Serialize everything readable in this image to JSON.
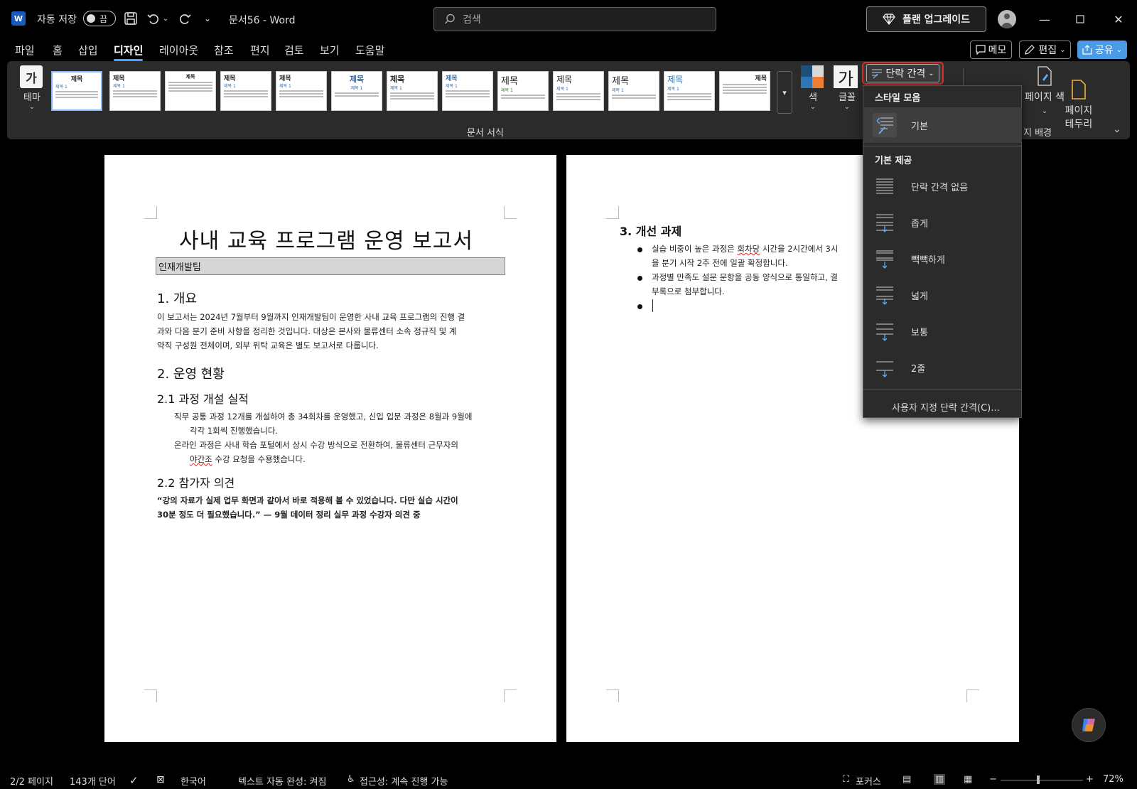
{
  "titlebar": {
    "autosave_label": "자동 저장",
    "autosave_state": "끔",
    "doc_title": "문서56  -  Word",
    "search_placeholder": "검색",
    "upgrade_label": "플랜 업그레이드"
  },
  "tabs": [
    {
      "label": "파일"
    },
    {
      "label": "홈"
    },
    {
      "label": "삽입"
    },
    {
      "label": "디자인"
    },
    {
      "label": "레이아웃"
    },
    {
      "label": "참조"
    },
    {
      "label": "편지"
    },
    {
      "label": "검토"
    },
    {
      "label": "보기"
    },
    {
      "label": "도움말"
    }
  ],
  "header_buttons": {
    "memo": "메모",
    "edit": "편집",
    "share": "공유"
  },
  "ribbon": {
    "theme_label": "테마",
    "color_label": "색",
    "font_label": "글꼴",
    "paragraph_spacing_label": "단락 간격",
    "page_color_label": "페이지 색",
    "page_border_label": "페이지\n테두리",
    "group_document_format": "문서 서식",
    "group_page_background": "지 배경",
    "thumb_title": "제목",
    "thumb_sub": "제목 1",
    "accent": "#4ea1ff"
  },
  "menu": {
    "style_header": "스타일 모음",
    "builtin_header": "기본 제공",
    "items": [
      {
        "label": "기본"
      },
      {
        "label": "단락 간격 없음"
      },
      {
        "label": "좁게"
      },
      {
        "label": "빽빽하게"
      },
      {
        "label": "넓게"
      },
      {
        "label": "보통"
      },
      {
        "label": "2줄"
      }
    ],
    "custom": "사용자 지정 단락 간격(C)..."
  },
  "page1": {
    "title": "사내 교육 프로그램 운영 보고서",
    "subtitle": "인재개발팀",
    "h1_overview": "1. 개요",
    "overview_l1": "이 보고서는 2024년 7월부터 9월까지 인재개발팀이 운영한 사내 교육 프로그램의 진행 결",
    "overview_l2": "과와 다음 분기 준비 사항을 정리한 것입니다. 대상은 본사와 물류센터 소속 정규직 및 계",
    "overview_l3": "약직 구성원 전체이며, 외부 위탁 교육은 별도 보고서로 다룹니다.",
    "h1_status": "2. 운영 현황",
    "h2_courses": "2.1 과정 개설 실적",
    "courses_l1": "직무 공통 과정 12개를 개설하여 총 34회차를 운영했고, 신입 입문 과정은 8월과 9월에",
    "courses_l2": "각각 1회씩 진행했습니다.",
    "courses_l3": "온라인 과정은 사내 학습 포털에서 상시 수강 방식으로 전환하여, 물류센터 근무자의",
    "courses_l4a": "야간조",
    "courses_l4b": " 수강 요청을 수용했습니다.",
    "h2_feedback": "2.2 참가자 의견",
    "feedback_l1": "“강의 자료가 실제 업무 화면과 같아서 바로 적용해 볼 수 있었습니다. 다만 실습 시간이",
    "feedback_l2": "30분 정도 더 필요했습니다.” — 9월 데이터 정리 실무 과정 수강자 의견 중"
  },
  "page2": {
    "h1_tasks": "3. 개선 과제",
    "b1_l1a": "실습 비중이 높은 과정은 ",
    "b1_l1b": "회차당",
    "b1_l1c": " 시간을 2시간에서 3시",
    "b1_l2": "을 분기 시작 2주 전에 일괄 확정합니다.",
    "b2_l1": "과정별 만족도 설문 문항을 공동 양식으로 통일하고, 결",
    "b2_l2": "부록으로 첨부합니다."
  },
  "status": {
    "page": "2/2 페이지",
    "words": "143개 단어",
    "language": "한국어",
    "autocomplete": "텍스트 자동 완성: 켜짐",
    "accessibility": "접근성: 계속 진행 가능",
    "focus": "포커스",
    "zoom": "72%",
    "zoom_level": 0.46
  }
}
